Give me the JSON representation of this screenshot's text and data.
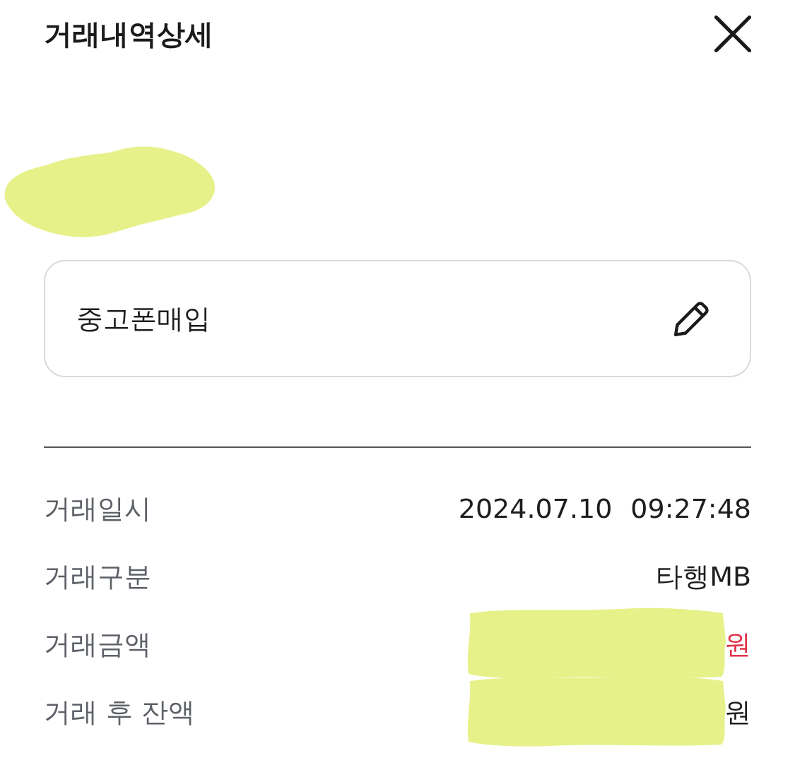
{
  "header": {
    "title": "거래내역상세"
  },
  "holder": {
    "redacted": true
  },
  "memo": {
    "text": "중고폰매입"
  },
  "details": {
    "rows": [
      {
        "label": "거래일시",
        "values": [
          "2024.07.10",
          "09:27:48"
        ],
        "color": "#1e1e1e",
        "redacted": false
      },
      {
        "label": "거래구분",
        "values": [
          "타행MB"
        ],
        "color": "#1e1e1e",
        "redacted": false
      },
      {
        "label": "거래금액",
        "values": [
          "원"
        ],
        "color": "#e03347",
        "redacted": true
      },
      {
        "label": "거래 후 잔액",
        "values": [
          "원"
        ],
        "color": "#1e1e1e",
        "redacted": true
      }
    ]
  }
}
